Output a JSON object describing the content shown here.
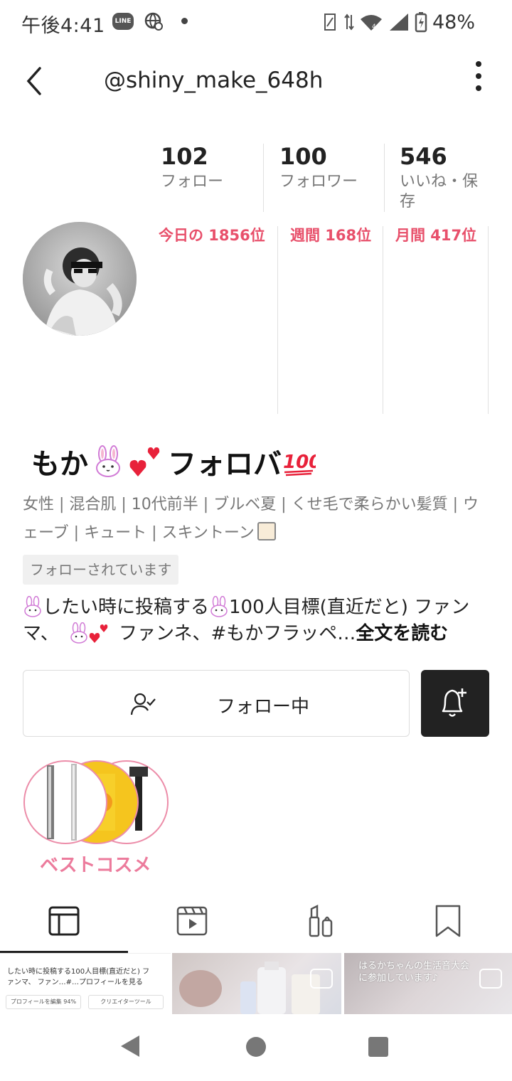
{
  "status_bar": {
    "time": "午後4:41",
    "line_badge": "LINE",
    "battery": "48%"
  },
  "header": {
    "handle": "@shiny_make_648h"
  },
  "stats": {
    "following_count": "102",
    "following_label": "フォロー",
    "followers_count": "100",
    "followers_label": "フォロワー",
    "likes_count": "546",
    "likes_label_line1": "いいね・保",
    "likes_label_line2": "存"
  },
  "ranks": {
    "daily": "今日の 1856位",
    "weekly": "週間 168位",
    "monthly": "月間 417位"
  },
  "profile": {
    "name": "もか",
    "name_suffix": "フォロバ",
    "attributes_line1": "女性 | 混合肌 | 10代前半 | ブルベ夏 | くせ毛で柔らかい髪質 | ウ",
    "attributes_line2": "ェーブ | キュート | スキントーン",
    "followed_badge": "フォローされています",
    "bio_part1": "したい時に投稿する",
    "bio_part2": "100人目標(直近だと) ファン",
    "bio_part3": "マ、",
    "bio_part4": " ファンネ、#もかフラッペ…",
    "bio_read_more": "全文を読む"
  },
  "actions": {
    "follow_label": "フォロー中"
  },
  "collection": {
    "label": "ベストコスメ"
  },
  "grid": {
    "preview_text_1": "したい時に投稿する",
    "preview_text_2": "100人目標(直近だと) フ",
    "preview_text_3": "ァンマ、",
    "preview_text_4": " ファン…#…プロフィールを見る",
    "edit_profile": "プロフィールを編集 94%",
    "creator_tools": "クリエイターツール",
    "overlay_line1": "はるかちゃんの生活音大会",
    "overlay_line2": "に参加しています♪"
  },
  "colors": {
    "accent_pink": "#e8506b",
    "collection_pink": "#ec7b9c",
    "dark_button": "#222222"
  },
  "icons": {
    "back": "chevron-left-icon",
    "more": "more-vertical-icon",
    "follow": "user-check-icon",
    "bell": "bell-plus-icon",
    "tab_grid": "grid-icon",
    "tab_video": "video-icon",
    "tab_cosme": "cosmetics-icon",
    "tab_saved": "bookmark-icon"
  }
}
